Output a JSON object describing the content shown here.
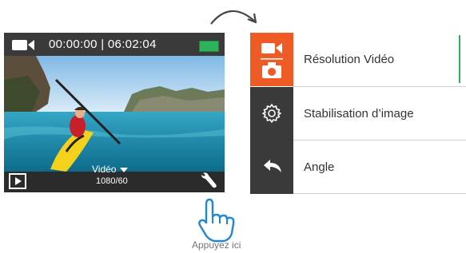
{
  "camera": {
    "timer": "00:00:00 | 06:02:04",
    "mode_label": "Vidéo",
    "resolution_fps": "1080/60",
    "icons": {
      "record": "video-camera-icon",
      "battery": "battery-icon",
      "playback": "playback-icon",
      "settings": "wrench-icon",
      "mode_dropdown": "caret-down-icon"
    }
  },
  "menu": {
    "items": [
      {
        "label": "Résolution Vidéo",
        "icon": "video-photo-icon",
        "active": true
      },
      {
        "label": "Stabilisation d’image",
        "icon": "gear-icon",
        "active": false
      },
      {
        "label": "Angle",
        "icon": "back-arrow-icon",
        "active": false
      }
    ]
  },
  "gesture": {
    "caption": "Appuyez ici",
    "icon": "tap-hand-icon"
  },
  "colors": {
    "accent": "#ef5b25",
    "battery": "#2db35c",
    "tile_dark": "#3a3a3a"
  }
}
